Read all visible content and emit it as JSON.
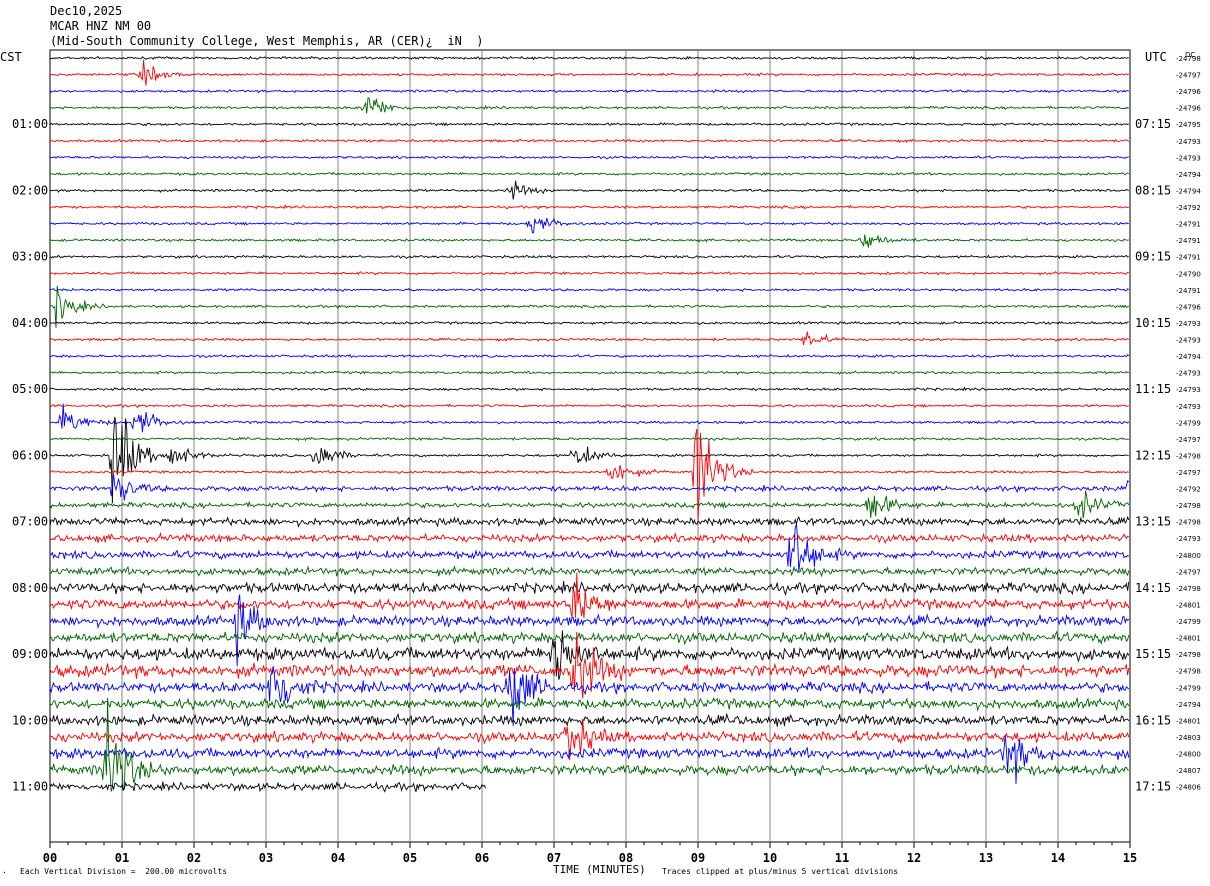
{
  "header": {
    "date": "Dec10,2025",
    "station": "MCAR HNZ NM 00",
    "location": "(Mid-South Community College, West Memphis, AR (CER­­)¿  iN  )"
  },
  "left_tz": "CST",
  "right_tz": "UTC",
  "dc_label": "DC",
  "footer": {
    "xlabel": "TIME (MINUTES)",
    "scale_note": "Each Vertical Division =  200.00 microvolts",
    "clip_note": "Traces clipped at plus/minus 5 vertical divisions",
    "corner_mark": "."
  },
  "colors": {
    "trace_cycle": [
      "#000000",
      "#ff0000",
      "#0000ff",
      "#006400"
    ],
    "grid": "#808080",
    "background": "#ffffff"
  },
  "chart_data": {
    "type": "line",
    "title": "Dec10,2025",
    "xlabel": "TIME (MINUTES)",
    "xlim": [
      0,
      15
    ],
    "x_ticks": [
      "00",
      "01",
      "02",
      "03",
      "04",
      "05",
      "06",
      "07",
      "08",
      "09",
      "10",
      "11",
      "12",
      "13",
      "14",
      "15"
    ],
    "left_hour_labels": [
      "01:00",
      "02:00",
      "03:00",
      "04:00",
      "05:00",
      "06:00",
      "07:00",
      "08:00",
      "09:00",
      "10:00",
      "11:00"
    ],
    "right_hour_labels": [
      "07:15",
      "08:15",
      "09:15",
      "10:15",
      "11:15",
      "12:15",
      "13:15",
      "14:15",
      "15:15",
      "16:15",
      "17:15"
    ],
    "trace_count": 45,
    "last_trace_minutes": 6.05,
    "dc_offsets": [
      "24798",
      "24797",
      "24796",
      "24796",
      "24795",
      "24793",
      "24793",
      "24794",
      "24794",
      "24792",
      "24791",
      "24791",
      "24791",
      "24790",
      "24791",
      "24796",
      "24793",
      "24793",
      "24794",
      "24793",
      "24793",
      "24793",
      "24799",
      "24797",
      "24798",
      "24797",
      "24792",
      "24798",
      "24798",
      "24793",
      "24800",
      "24797",
      "24798",
      "24801",
      "24799",
      "24801",
      "24798",
      "24798",
      "24799",
      "24794",
      "24801",
      "24803",
      "24800",
      "24807",
      "24806"
    ],
    "activity_level": [
      1,
      1,
      1,
      1,
      1,
      1,
      1,
      1,
      1,
      1,
      1,
      1,
      1,
      1,
      1,
      1,
      1,
      1,
      1,
      1,
      1,
      1,
      1,
      1,
      1,
      1,
      2,
      2,
      3,
      3,
      3,
      3,
      4,
      4,
      4,
      4,
      5,
      5,
      4,
      4,
      4,
      4,
      4,
      4,
      3
    ],
    "events": [
      {
        "trace": 1,
        "minute": 1.3,
        "amp": 0.7
      },
      {
        "trace": 3,
        "minute": 4.4,
        "amp": 1.2
      },
      {
        "trace": 8,
        "minute": 6.4,
        "amp": 0.6
      },
      {
        "trace": 10,
        "minute": 6.7,
        "amp": 0.9
      },
      {
        "trace": 11,
        "minute": 11.3,
        "amp": 0.8
      },
      {
        "trace": 15,
        "minute": 0.1,
        "amp": 1.3
      },
      {
        "trace": 17,
        "minute": 10.5,
        "amp": 0.7
      },
      {
        "trace": 22,
        "minute": 0.2,
        "amp": 1.2
      },
      {
        "trace": 22,
        "minute": 1.2,
        "amp": 1.3
      },
      {
        "trace": 24,
        "minute": 0.9,
        "amp": 4.5
      },
      {
        "trace": 24,
        "minute": 3.7,
        "amp": 1.2
      },
      {
        "trace": 24,
        "minute": 7.3,
        "amp": 1.0
      },
      {
        "trace": 24,
        "minute": 1.7,
        "amp": 1.0
      },
      {
        "trace": 25,
        "minute": 9.0,
        "amp": 4.5
      },
      {
        "trace": 25,
        "minute": 7.8,
        "amp": 1.0
      },
      {
        "trace": 26,
        "minute": 0.9,
        "amp": 1.2
      },
      {
        "trace": 26,
        "minute": 15.0,
        "amp": 1.2
      },
      {
        "trace": 27,
        "minute": 11.4,
        "amp": 1.2
      },
      {
        "trace": 27,
        "minute": 14.3,
        "amp": 1.0
      },
      {
        "trace": 30,
        "minute": 10.3,
        "amp": 3.0
      },
      {
        "trace": 33,
        "minute": 7.3,
        "amp": 2.0
      },
      {
        "trace": 34,
        "minute": 2.6,
        "amp": 2.0
      },
      {
        "trace": 36,
        "minute": 7.0,
        "amp": 3.0
      },
      {
        "trace": 37,
        "minute": 7.3,
        "amp": 3.0
      },
      {
        "trace": 38,
        "minute": 3.1,
        "amp": 3.0
      },
      {
        "trace": 38,
        "minute": 6.4,
        "amp": 3.0
      },
      {
        "trace": 41,
        "minute": 7.2,
        "amp": 2.0
      },
      {
        "trace": 42,
        "minute": 13.3,
        "amp": 2.0
      },
      {
        "trace": 43,
        "minute": 0.8,
        "amp": 4.5
      }
    ]
  }
}
